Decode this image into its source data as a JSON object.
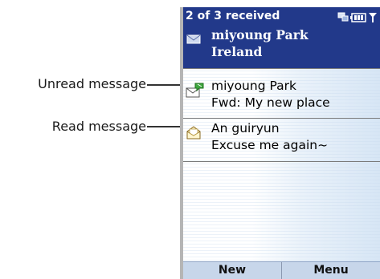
{
  "callouts": {
    "unread": "Unread message",
    "read": "Read message"
  },
  "titlebar": {
    "text": "2 of 3 received",
    "icons": [
      "sync-icon",
      "battery-icon",
      "signal-icon"
    ]
  },
  "messages": [
    {
      "sender": "miyoung Park",
      "subject": "Ireland",
      "state": "selected",
      "icon": "envelope-icon"
    },
    {
      "sender": "miyoung Park",
      "subject": "Fwd: My new place",
      "state": "unread",
      "icon": "unread-envelope-icon"
    },
    {
      "sender": "An guiryun",
      "subject": "Excuse me again~",
      "state": "read",
      "icon": "read-envelope-icon"
    }
  ],
  "softkeys": {
    "left": "New",
    "right": "Menu"
  },
  "colors": {
    "titlebar": "#22398a",
    "selection": "#22398a",
    "softkey_bar": "#c7d6ea"
  }
}
